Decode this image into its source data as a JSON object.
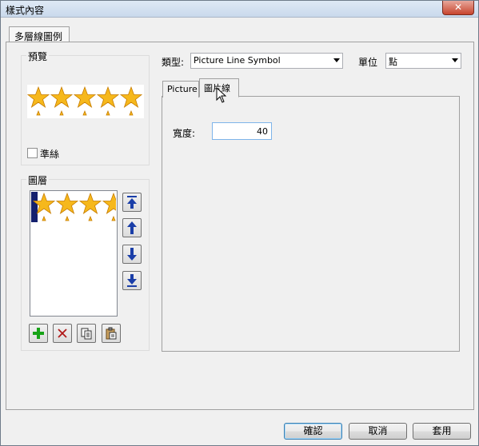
{
  "window": {
    "title": "樣式內容",
    "close_glyph": "✕"
  },
  "outer_tab": {
    "label": "多層線圖例"
  },
  "preview": {
    "label": "預覽",
    "guide_checkbox_label": "準絲",
    "guide_checked": false
  },
  "layers": {
    "label": "圖層"
  },
  "type_field": {
    "label": "類型:",
    "value": "Picture Line Symbol"
  },
  "unit_field": {
    "label": "單位",
    "value": "點"
  },
  "inner_tabs": [
    {
      "label": "Picture",
      "active": false
    },
    {
      "label": "圖片線",
      "active": true
    }
  ],
  "width_field": {
    "label": "寬度:",
    "value": "40"
  },
  "layer_tools": {
    "move_top": "move-to-top-icon",
    "move_up": "move-up-icon",
    "move_down": "move-down-icon",
    "move_bottom": "move-to-bottom-icon",
    "add": "add-icon",
    "delete": "delete-icon",
    "copy": "copy-icon",
    "paste": "paste-icon"
  },
  "buttons": {
    "ok": "確認",
    "cancel": "取消",
    "apply": "套用"
  },
  "colors": {
    "star_fill": "#f6b81c",
    "star_stroke": "#c77d00",
    "arrow_blue": "#1a3ea8",
    "layer_bg": "#14206e",
    "add_green": "#17a317",
    "delete_red": "#b01818"
  }
}
